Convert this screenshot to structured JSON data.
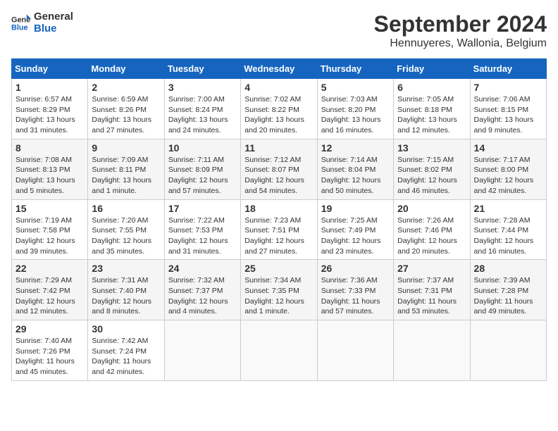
{
  "logo": {
    "line1": "General",
    "line2": "Blue"
  },
  "title": "September 2024",
  "subtitle": "Hennuyeres, Wallonia, Belgium",
  "days_of_week": [
    "Sunday",
    "Monday",
    "Tuesday",
    "Wednesday",
    "Thursday",
    "Friday",
    "Saturday"
  ],
  "weeks": [
    [
      {
        "day": "1",
        "sunrise": "Sunrise: 6:57 AM",
        "sunset": "Sunset: 8:29 PM",
        "daylight": "Daylight: 13 hours and 31 minutes."
      },
      {
        "day": "2",
        "sunrise": "Sunrise: 6:59 AM",
        "sunset": "Sunset: 8:26 PM",
        "daylight": "Daylight: 13 hours and 27 minutes."
      },
      {
        "day": "3",
        "sunrise": "Sunrise: 7:00 AM",
        "sunset": "Sunset: 8:24 PM",
        "daylight": "Daylight: 13 hours and 24 minutes."
      },
      {
        "day": "4",
        "sunrise": "Sunrise: 7:02 AM",
        "sunset": "Sunset: 8:22 PM",
        "daylight": "Daylight: 13 hours and 20 minutes."
      },
      {
        "day": "5",
        "sunrise": "Sunrise: 7:03 AM",
        "sunset": "Sunset: 8:20 PM",
        "daylight": "Daylight: 13 hours and 16 minutes."
      },
      {
        "day": "6",
        "sunrise": "Sunrise: 7:05 AM",
        "sunset": "Sunset: 8:18 PM",
        "daylight": "Daylight: 13 hours and 12 minutes."
      },
      {
        "day": "7",
        "sunrise": "Sunrise: 7:06 AM",
        "sunset": "Sunset: 8:15 PM",
        "daylight": "Daylight: 13 hours and 9 minutes."
      }
    ],
    [
      {
        "day": "8",
        "sunrise": "Sunrise: 7:08 AM",
        "sunset": "Sunset: 8:13 PM",
        "daylight": "Daylight: 13 hours and 5 minutes."
      },
      {
        "day": "9",
        "sunrise": "Sunrise: 7:09 AM",
        "sunset": "Sunset: 8:11 PM",
        "daylight": "Daylight: 13 hours and 1 minute."
      },
      {
        "day": "10",
        "sunrise": "Sunrise: 7:11 AM",
        "sunset": "Sunset: 8:09 PM",
        "daylight": "Daylight: 12 hours and 57 minutes."
      },
      {
        "day": "11",
        "sunrise": "Sunrise: 7:12 AM",
        "sunset": "Sunset: 8:07 PM",
        "daylight": "Daylight: 12 hours and 54 minutes."
      },
      {
        "day": "12",
        "sunrise": "Sunrise: 7:14 AM",
        "sunset": "Sunset: 8:04 PM",
        "daylight": "Daylight: 12 hours and 50 minutes."
      },
      {
        "day": "13",
        "sunrise": "Sunrise: 7:15 AM",
        "sunset": "Sunset: 8:02 PM",
        "daylight": "Daylight: 12 hours and 46 minutes."
      },
      {
        "day": "14",
        "sunrise": "Sunrise: 7:17 AM",
        "sunset": "Sunset: 8:00 PM",
        "daylight": "Daylight: 12 hours and 42 minutes."
      }
    ],
    [
      {
        "day": "15",
        "sunrise": "Sunrise: 7:19 AM",
        "sunset": "Sunset: 7:58 PM",
        "daylight": "Daylight: 12 hours and 39 minutes."
      },
      {
        "day": "16",
        "sunrise": "Sunrise: 7:20 AM",
        "sunset": "Sunset: 7:55 PM",
        "daylight": "Daylight: 12 hours and 35 minutes."
      },
      {
        "day": "17",
        "sunrise": "Sunrise: 7:22 AM",
        "sunset": "Sunset: 7:53 PM",
        "daylight": "Daylight: 12 hours and 31 minutes."
      },
      {
        "day": "18",
        "sunrise": "Sunrise: 7:23 AM",
        "sunset": "Sunset: 7:51 PM",
        "daylight": "Daylight: 12 hours and 27 minutes."
      },
      {
        "day": "19",
        "sunrise": "Sunrise: 7:25 AM",
        "sunset": "Sunset: 7:49 PM",
        "daylight": "Daylight: 12 hours and 23 minutes."
      },
      {
        "day": "20",
        "sunrise": "Sunrise: 7:26 AM",
        "sunset": "Sunset: 7:46 PM",
        "daylight": "Daylight: 12 hours and 20 minutes."
      },
      {
        "day": "21",
        "sunrise": "Sunrise: 7:28 AM",
        "sunset": "Sunset: 7:44 PM",
        "daylight": "Daylight: 12 hours and 16 minutes."
      }
    ],
    [
      {
        "day": "22",
        "sunrise": "Sunrise: 7:29 AM",
        "sunset": "Sunset: 7:42 PM",
        "daylight": "Daylight: 12 hours and 12 minutes."
      },
      {
        "day": "23",
        "sunrise": "Sunrise: 7:31 AM",
        "sunset": "Sunset: 7:40 PM",
        "daylight": "Daylight: 12 hours and 8 minutes."
      },
      {
        "day": "24",
        "sunrise": "Sunrise: 7:32 AM",
        "sunset": "Sunset: 7:37 PM",
        "daylight": "Daylight: 12 hours and 4 minutes."
      },
      {
        "day": "25",
        "sunrise": "Sunrise: 7:34 AM",
        "sunset": "Sunset: 7:35 PM",
        "daylight": "Daylight: 12 hours and 1 minute."
      },
      {
        "day": "26",
        "sunrise": "Sunrise: 7:36 AM",
        "sunset": "Sunset: 7:33 PM",
        "daylight": "Daylight: 11 hours and 57 minutes."
      },
      {
        "day": "27",
        "sunrise": "Sunrise: 7:37 AM",
        "sunset": "Sunset: 7:31 PM",
        "daylight": "Daylight: 11 hours and 53 minutes."
      },
      {
        "day": "28",
        "sunrise": "Sunrise: 7:39 AM",
        "sunset": "Sunset: 7:28 PM",
        "daylight": "Daylight: 11 hours and 49 minutes."
      }
    ],
    [
      {
        "day": "29",
        "sunrise": "Sunrise: 7:40 AM",
        "sunset": "Sunset: 7:26 PM",
        "daylight": "Daylight: 11 hours and 45 minutes."
      },
      {
        "day": "30",
        "sunrise": "Sunrise: 7:42 AM",
        "sunset": "Sunset: 7:24 PM",
        "daylight": "Daylight: 11 hours and 42 minutes."
      },
      null,
      null,
      null,
      null,
      null
    ]
  ]
}
